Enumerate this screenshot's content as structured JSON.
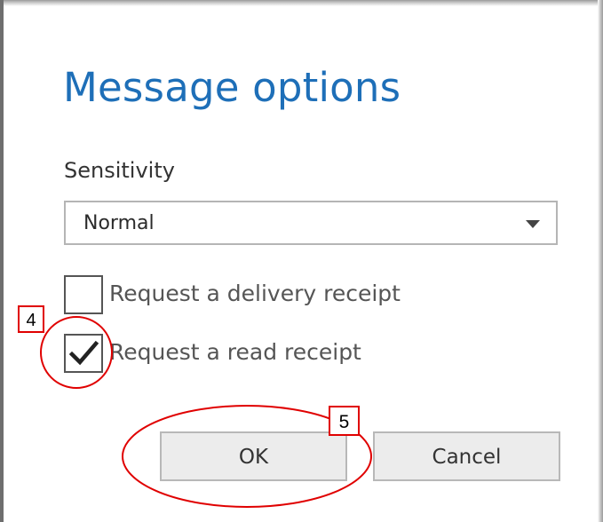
{
  "dialog": {
    "title": "Message options"
  },
  "sensitivity": {
    "label": "Sensitivity",
    "selected": "Normal"
  },
  "checkboxes": [
    {
      "label": "Request a delivery receipt",
      "checked": false
    },
    {
      "label": "Request a read receipt",
      "checked": true
    }
  ],
  "buttons": {
    "ok_label": "OK",
    "cancel_label": "Cancel"
  },
  "annotations": {
    "step_4": "4",
    "step_5": "5",
    "color": "#e00000"
  },
  "colors": {
    "title": "#1e6fb8",
    "button_bg": "#ececec"
  },
  "icons": [
    "chevron-down-icon",
    "checkmark-icon"
  ]
}
